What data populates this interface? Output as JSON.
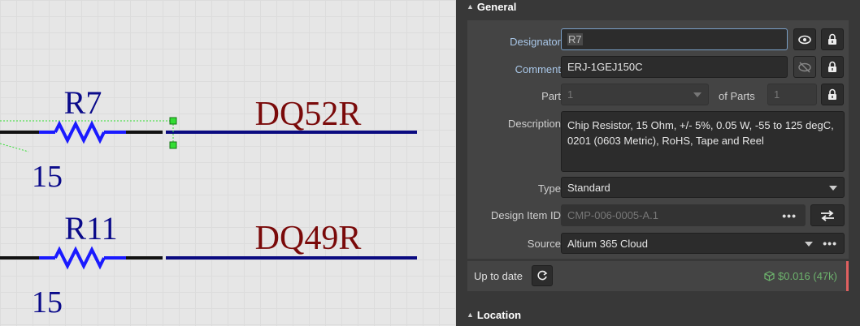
{
  "schematic": {
    "parts": [
      {
        "designator": "R7",
        "value": "15",
        "net": "DQ52R"
      },
      {
        "designator": "R11",
        "value": "15",
        "net": "DQ49R"
      }
    ],
    "colors": {
      "designator": "#0a0a8a",
      "net": "#7a0a0a",
      "wire": "#0a0a80",
      "resistor": "#1a1aff",
      "pin": "#111111",
      "handle": "#33dd33"
    }
  },
  "panel": {
    "general_header": "General",
    "location_header": "Location",
    "designator": {
      "label": "Designator",
      "value": "R7"
    },
    "comment": {
      "label": "Comment",
      "value": "ERJ-1GEJ150C"
    },
    "part": {
      "label": "Part",
      "value": "1",
      "of_parts_label": "of Parts",
      "of_parts_value": "1"
    },
    "description": {
      "label": "Description",
      "value": "Chip Resistor, 15 Ohm, +/- 5%, 0.05 W, -55 to 125 degC, 0201 (0603 Metric), RoHS, Tape and Reel"
    },
    "type": {
      "label": "Type",
      "value": "Standard"
    },
    "design_item_id": {
      "label": "Design Item ID",
      "value": "CMP-006-0005-A.1",
      "more": "•••"
    },
    "source": {
      "label": "Source",
      "value": "Altium 365 Cloud",
      "more": "•••"
    },
    "status": {
      "label": "Up to date",
      "price": "$0.016 (47k)"
    },
    "icons": [
      "eye-icon",
      "lock-icon",
      "eye-slash-icon",
      "refresh-icon",
      "swap-icon",
      "cube-icon"
    ]
  }
}
